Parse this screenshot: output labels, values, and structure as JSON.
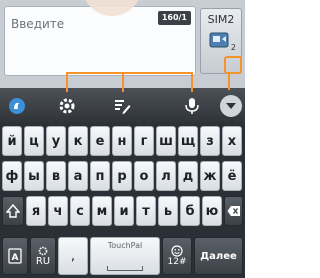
{
  "compose": {
    "message_placeholder": "Введите",
    "counter": "160/1",
    "sim_label": "SIM2",
    "sim_sub": "2"
  },
  "keyboard": {
    "row1": [
      "й",
      "ц",
      "у",
      "к",
      "е",
      "н",
      "г",
      "ш",
      "щ",
      "з",
      "х"
    ],
    "row2": [
      "ф",
      "ы",
      "в",
      "а",
      "п",
      "р",
      "о",
      "л",
      "д",
      "ж",
      "ё"
    ],
    "row3": [
      "я",
      "ч",
      "с",
      "м",
      "и",
      "т",
      "ь",
      "б",
      "ю"
    ],
    "lang_label": "RU",
    "comma": ",",
    "space_label": "TouchPal",
    "sym_label": "12#",
    "next_label": "Далее"
  },
  "colors": {
    "callout": "#f5932a",
    "toolbar_icon": "#ffffff"
  },
  "icons": {
    "settings": "gear-icon",
    "edit": "pen-icon",
    "voice": "microphone-icon",
    "collapse": "chevron-down-icon",
    "logo": "touchpal-logo-icon",
    "shift": "shift-icon",
    "backspace": "backspace-icon",
    "emoji": "smiley-icon",
    "keyboard_switch": "layout-icon"
  }
}
